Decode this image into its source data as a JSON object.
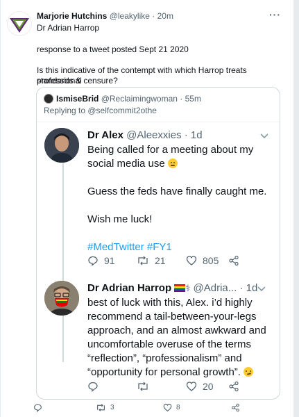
{
  "outer_tweet": {
    "display_name": "Marjorie Hutchins",
    "handle": "@leakylike",
    "separator": "·",
    "time": "20m",
    "subtitle": "Dr Adrian Harrop",
    "line1": "response to a tweet posted Sept 21 2020",
    "line2": "Is this indicative of the contempt with which Harrop treats professional",
    "line3": "standards & censure?",
    "more_label": "···",
    "actions": {
      "reply_count": "",
      "retweet_count": "3",
      "like_count": "8"
    }
  },
  "quoted": {
    "display_name": "IsmiseBrid",
    "handle": "@Reclaimingwoman",
    "separator": "·",
    "time": "55m",
    "replying_to": "Replying to @selfcommit2othe"
  },
  "alex_tweet": {
    "display_name": "Dr Alex",
    "handle": "@Aleexxies",
    "separator": "·",
    "time": "1d",
    "text1": "Being called for a meeting about my",
    "text2": "social media use",
    "text3": "Guess the feds have finally caught me.",
    "text4": "Wish me luck!",
    "hashtags": "#MedTwitter #FY1",
    "reply_count": "91",
    "retweet_count": "21",
    "like_count": "805"
  },
  "adrian_tweet": {
    "display_name": "Dr Adrian Harrop",
    "handle": "@Adria...",
    "separator": "·",
    "time": "1d",
    "lines": [
      "best of luck with this, Alex. i’d highly",
      "recommend a tail-between-your-legs",
      "approach, and an almost awkward and",
      "uncomfortable overuse of the terms",
      "“reflection”, “professionalism” and",
      "“opportunity for personal growth”."
    ],
    "reply_count": "",
    "retweet_count": "",
    "like_count": "20"
  },
  "colors": {
    "accent": "#1d9bf0",
    "muted": "#536471",
    "border": "#cfd9de"
  }
}
